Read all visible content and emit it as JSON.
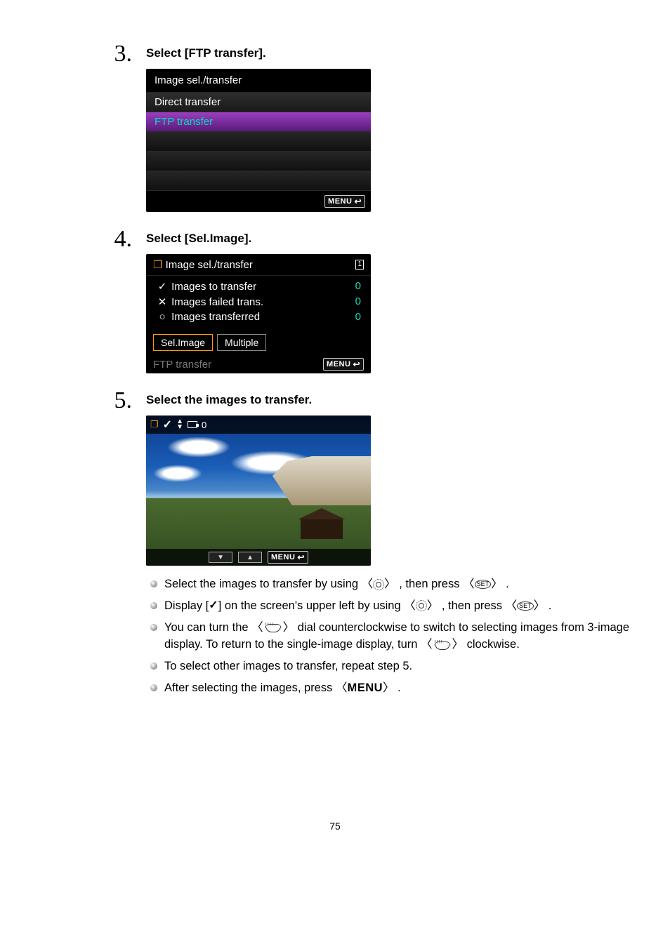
{
  "page_number": "75",
  "steps": {
    "s3": {
      "number": "3.",
      "title": "Select [FTP transfer].",
      "screen": {
        "title": "Image sel./transfer",
        "items": [
          "Direct transfer",
          "FTP transfer"
        ],
        "selected_index": 1,
        "menu_back": "MENU"
      }
    },
    "s4": {
      "number": "4.",
      "title": "Select [Sel.Image].",
      "screen": {
        "title_icon": "copy-icon",
        "title": "Image sel./transfer",
        "card_label": "1",
        "rows": [
          {
            "sym": "✓",
            "label": "Images to transfer",
            "value": "0"
          },
          {
            "sym": "✕",
            "label": "Images failed trans.",
            "value": "0"
          },
          {
            "sym": "○",
            "label": "Images transferred",
            "value": "0"
          }
        ],
        "buttons": [
          "Sel.Image",
          "Multiple"
        ],
        "selected_button_index": 0,
        "bottom_label": "FTP transfer",
        "menu_back": "MENU"
      }
    },
    "s5": {
      "number": "5.",
      "title": "Select the images to transfer.",
      "photo_overlay": {
        "count_label": "0",
        "menu_back": "MENU"
      },
      "bullets": {
        "b1a": "Select the images to transfer by using ",
        "b1b": " , then press ",
        "b1c": " .",
        "b2a": "Display [",
        "b2b": "] on the screen's upper left by using ",
        "b2c": " , then press ",
        "b2d": " .",
        "b3a": "You can turn the ",
        "b3b": " dial counterclockwise to switch to selecting images from 3-image display. To return to the single-image display, turn ",
        "b3c": " clockwise.",
        "b4": "To select other images to transfer, repeat step 5.",
        "b5a": "After selecting the images, press ",
        "b5b": " ."
      },
      "inline": {
        "set_label": "SET",
        "menu_label": "MENU",
        "check": "✓"
      }
    }
  }
}
